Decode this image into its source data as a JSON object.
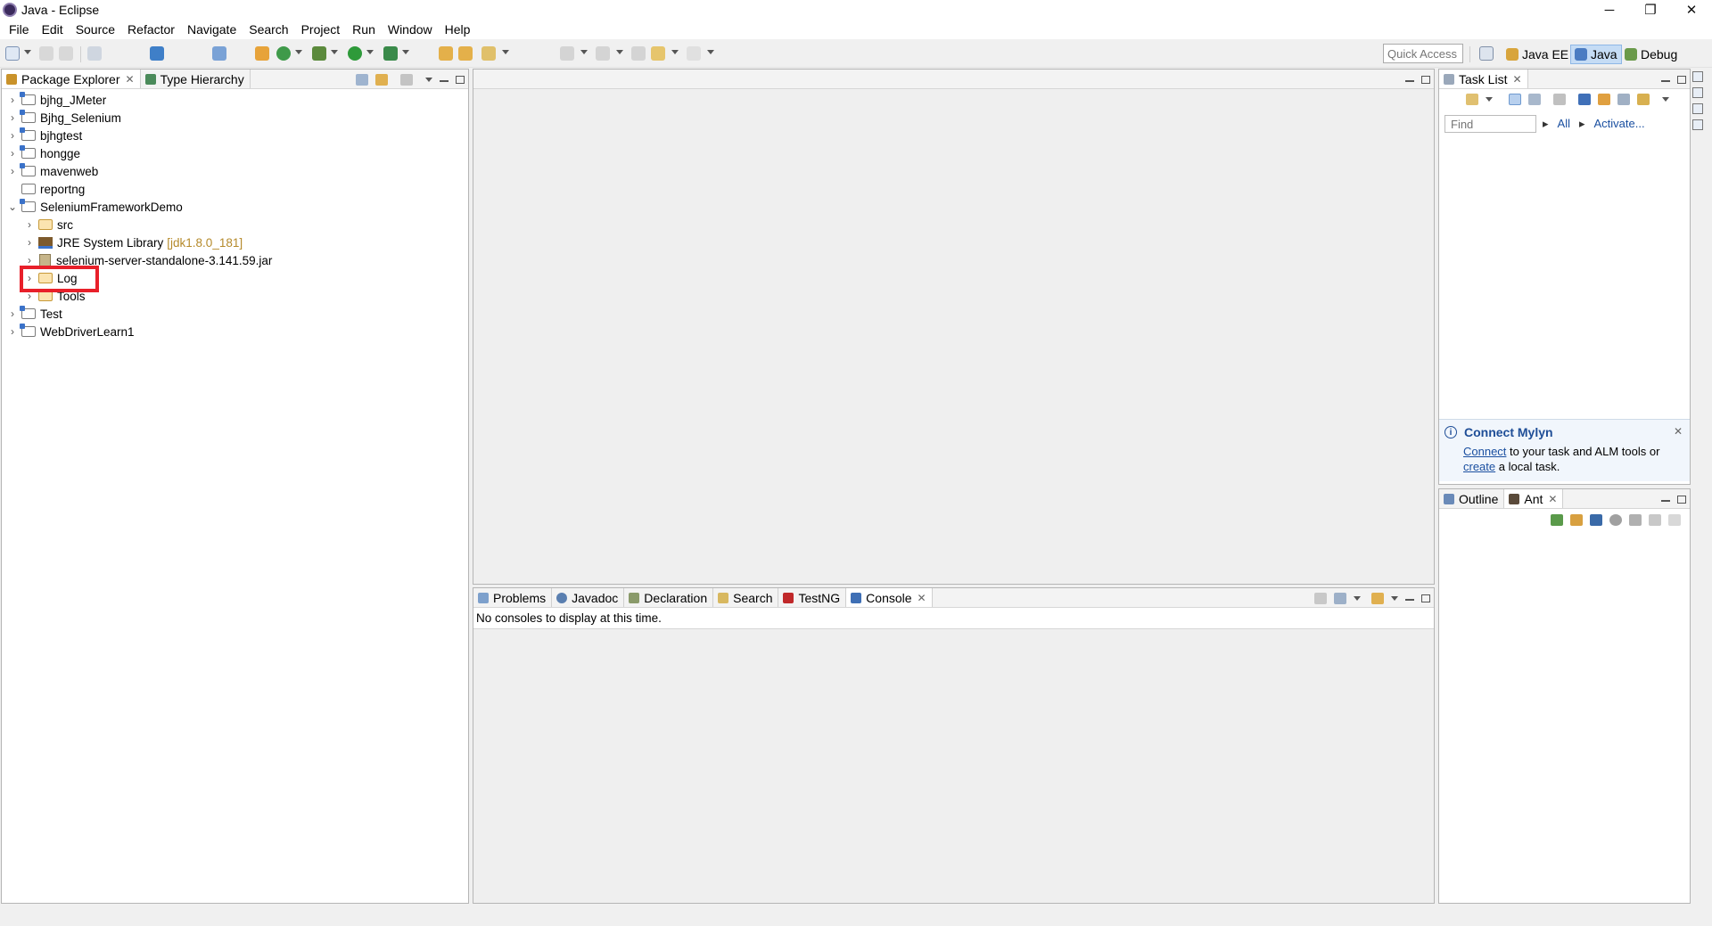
{
  "window": {
    "title": "Java - Eclipse",
    "minimize": "─",
    "restore": "❐",
    "close": "✕"
  },
  "menu": [
    "File",
    "Edit",
    "Source",
    "Refactor",
    "Navigate",
    "Search",
    "Project",
    "Run",
    "Window",
    "Help"
  ],
  "toolbar": {
    "quick_access_placeholder": "Quick Access",
    "perspectives": [
      {
        "label": "Java EE",
        "active": false
      },
      {
        "label": "Java",
        "active": true
      },
      {
        "label": "Debug",
        "active": false
      }
    ]
  },
  "package_explorer": {
    "tabs": [
      {
        "label": "Package Explorer",
        "active": true,
        "closable": true
      },
      {
        "label": "Type Hierarchy",
        "active": false,
        "closable": false
      }
    ],
    "tree": [
      {
        "label": "bjhg_JMeter",
        "expanded": false,
        "level": 0,
        "kind": "java-project"
      },
      {
        "label": "Bjhg_Selenium",
        "expanded": false,
        "level": 0,
        "kind": "java-project"
      },
      {
        "label": "bjhgtest",
        "expanded": false,
        "level": 0,
        "kind": "java-project"
      },
      {
        "label": "hongge",
        "expanded": false,
        "level": 0,
        "kind": "java-project"
      },
      {
        "label": "mavenweb",
        "expanded": false,
        "level": 0,
        "kind": "java-project"
      },
      {
        "label": "reportng",
        "expanded": null,
        "level": 0,
        "kind": "project"
      },
      {
        "label": "SeleniumFrameworkDemo",
        "expanded": true,
        "level": 0,
        "kind": "java-project"
      },
      {
        "label": "src",
        "expanded": false,
        "level": 1,
        "kind": "source-folder"
      },
      {
        "label": "JRE System Library",
        "suffix": "[jdk1.8.0_181]",
        "expanded": false,
        "level": 1,
        "kind": "library"
      },
      {
        "label": "selenium-server-standalone-3.141.59.jar",
        "expanded": false,
        "level": 1,
        "kind": "jar"
      },
      {
        "label": "Log",
        "expanded": false,
        "level": 1,
        "kind": "folder",
        "highlighted": true
      },
      {
        "label": "Tools",
        "expanded": false,
        "level": 1,
        "kind": "folder"
      },
      {
        "label": "Test",
        "expanded": false,
        "level": 0,
        "kind": "java-project"
      },
      {
        "label": "WebDriverLearn1",
        "expanded": false,
        "level": 0,
        "kind": "java-project"
      }
    ]
  },
  "bottom_panel": {
    "tabs": [
      {
        "label": "Problems",
        "active": false
      },
      {
        "label": "Javadoc",
        "active": false
      },
      {
        "label": "Declaration",
        "active": false
      },
      {
        "label": "Search",
        "active": false
      },
      {
        "label": "TestNG",
        "active": false
      },
      {
        "label": "Console",
        "active": true,
        "closable": true
      }
    ],
    "message": "No consoles to display at this time."
  },
  "task_list": {
    "tab": "Task List",
    "find_placeholder": "Find",
    "filter_all": "All",
    "filter_activate": "Activate...",
    "mylyn": {
      "title": "Connect Mylyn",
      "connect_link": "Connect",
      "text1": " to your task and ALM tools or",
      "create_link": "create",
      "text2": " a local task."
    }
  },
  "outline_panel": {
    "tabs": [
      {
        "label": "Outline",
        "active": false
      },
      {
        "label": "Ant",
        "active": true,
        "closable": true
      }
    ]
  },
  "colors": {
    "highlight": "#e8202a",
    "link": "#1a4fa0",
    "mylyn_title": "#1f4e97",
    "library_suffix": "#b58a2b"
  }
}
